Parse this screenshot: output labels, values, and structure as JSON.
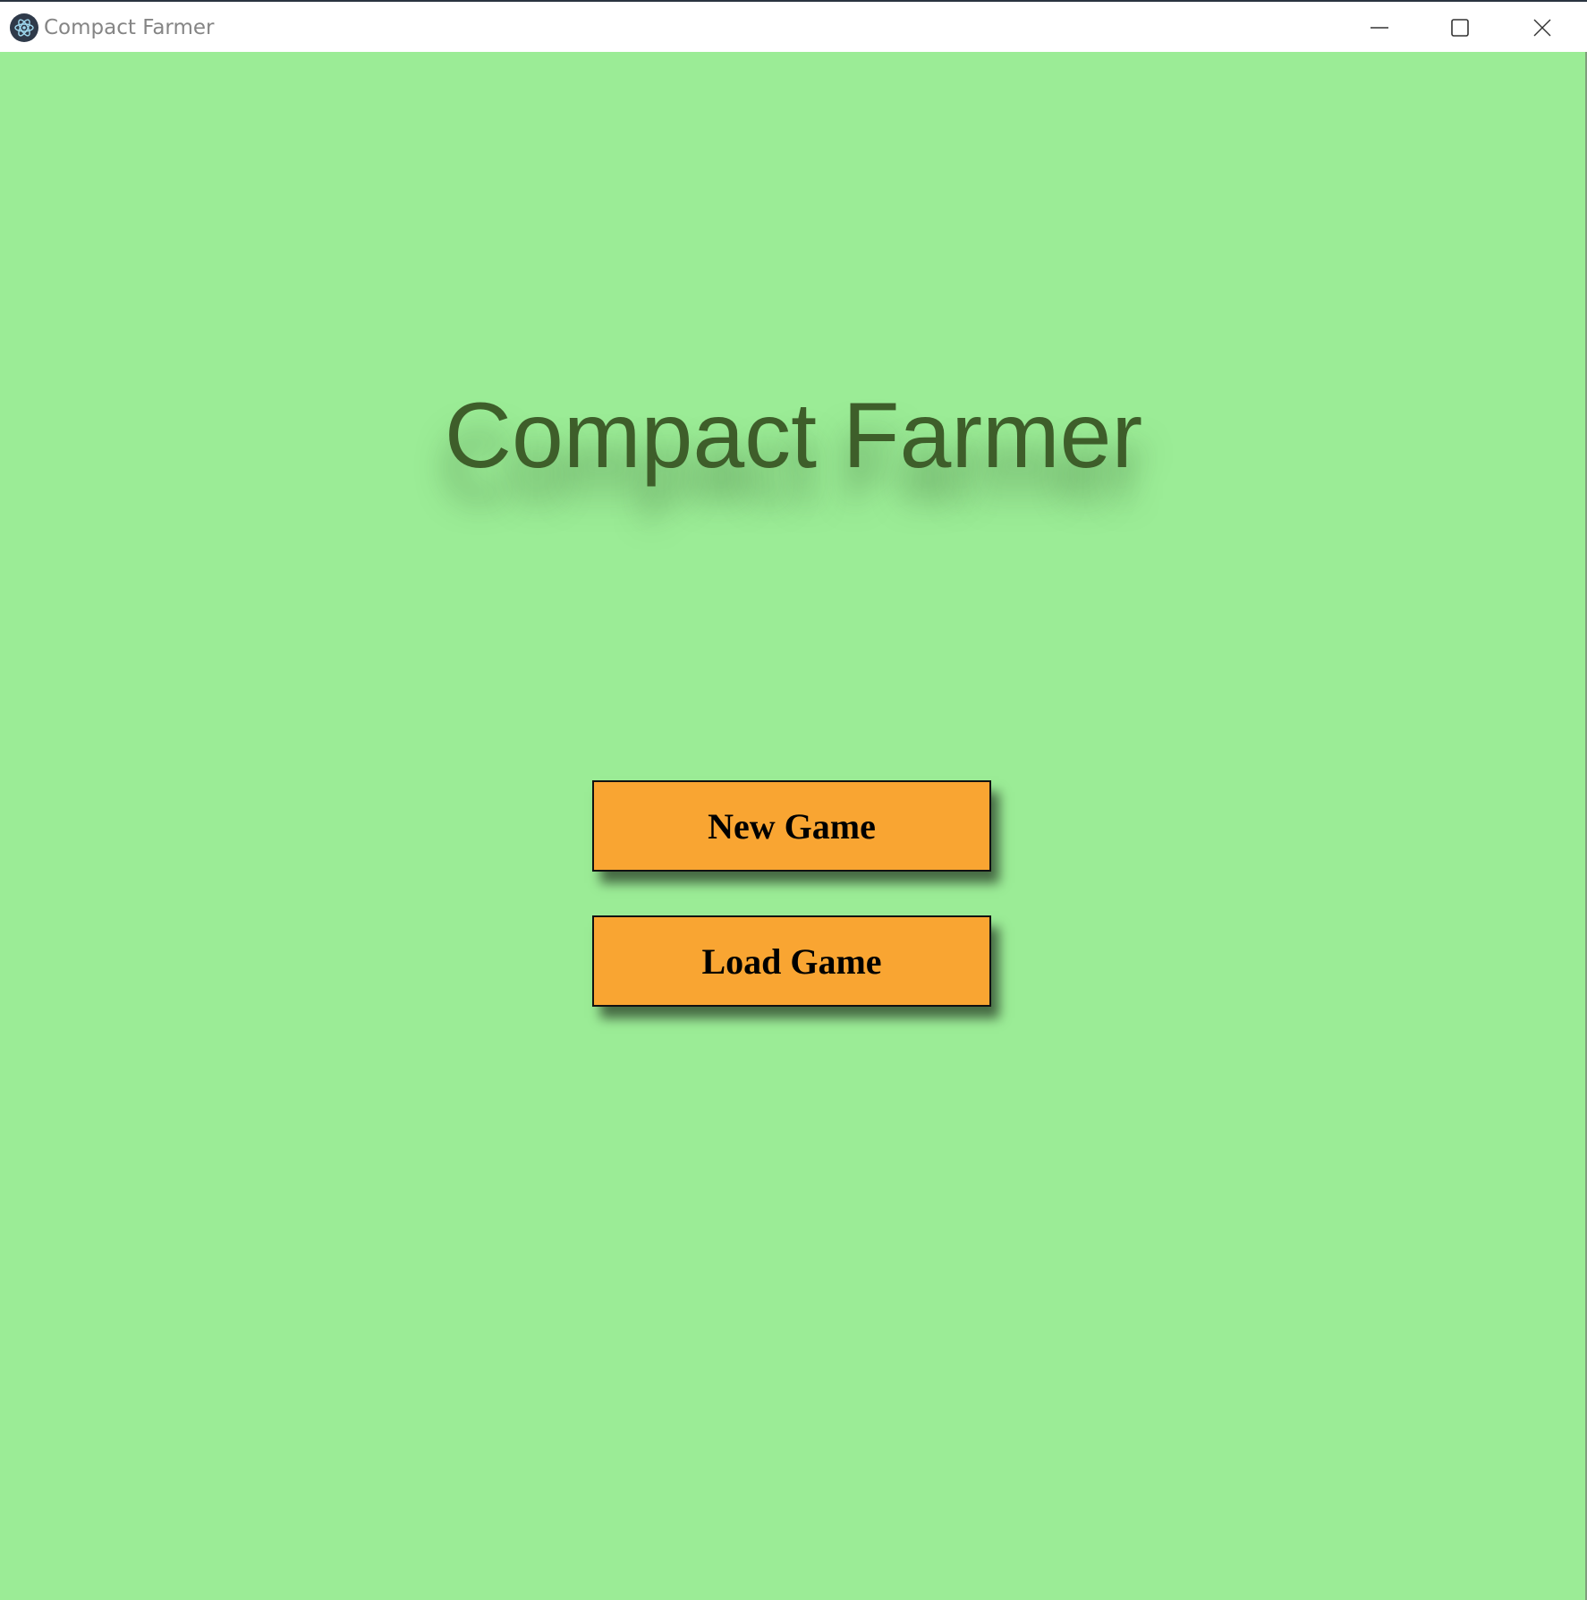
{
  "window": {
    "title": "Compact Farmer",
    "icon": "electron-atom-icon",
    "controls": {
      "minimize": "minimize-icon",
      "maximize": "maximize-icon",
      "close": "close-icon"
    }
  },
  "game": {
    "title": "Compact Farmer",
    "buttons": {
      "new_game": "New Game",
      "load_game": "Load Game"
    }
  },
  "colors": {
    "background": "#9bec96",
    "title_text": "#3e5e2a",
    "button_fill": "#f9a532",
    "button_border": "#111111"
  }
}
